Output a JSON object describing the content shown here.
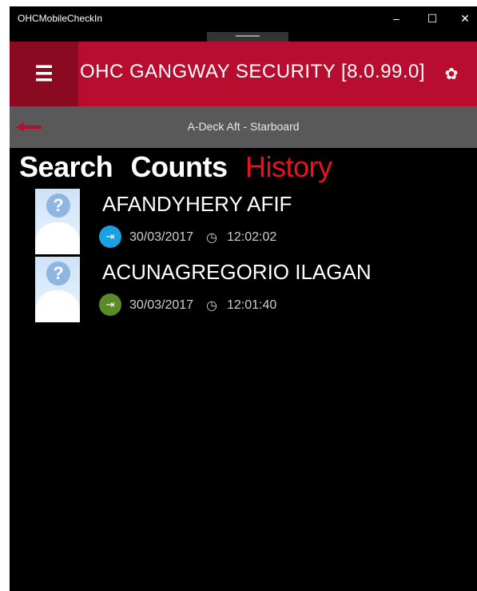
{
  "window": {
    "title": "OHCMobileCheckIn",
    "minimize_glyph": "–",
    "maximize_glyph": "☐",
    "close_glyph": "✕"
  },
  "header": {
    "title": "OHC GANGWAY SECURITY [8.0.99.0]",
    "menu_icon": "hamburger-menu-icon",
    "settings_icon": "gear-icon",
    "color": "#b80d2e",
    "menu_bg": "#8a0a22"
  },
  "subbar": {
    "location": "A-Deck Aft - Starboard",
    "back_icon": "back-arrow-icon",
    "back_color": "#b80d2e"
  },
  "tabs": [
    {
      "label": "Search",
      "active": false
    },
    {
      "label": "Counts",
      "active": false
    },
    {
      "label": "History",
      "active": true
    }
  ],
  "history": [
    {
      "name": "AFANDYHERY AFIF",
      "date": "30/03/2017",
      "time": "12:02:02",
      "badge_color": "#1ba1e2",
      "direction_icon": "sign-in-icon"
    },
    {
      "name": "ACUNAGREGORIO ILAGAN",
      "date": "30/03/2017",
      "time": "12:01:40",
      "badge_color": "#5a8a2a",
      "direction_icon": "sign-in-icon"
    }
  ]
}
